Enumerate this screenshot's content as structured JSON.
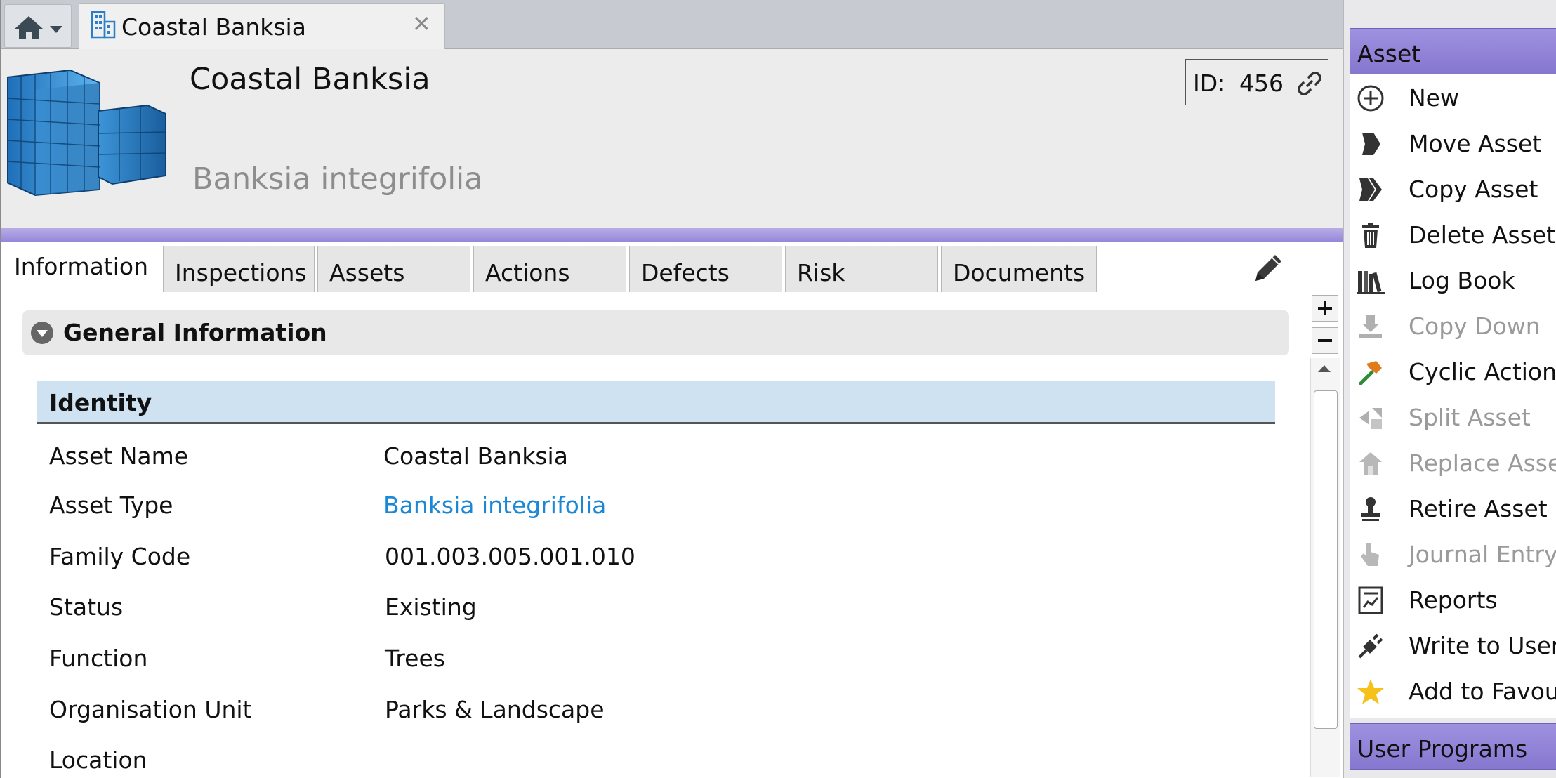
{
  "tab_strip": {
    "document_tab_title": "Coastal Banksia",
    "close_glyph": "✕"
  },
  "header": {
    "asset_title": "Coastal Banksia",
    "asset_subtitle": "Banksia integrifolia",
    "id_label": "ID:",
    "id_value": "456"
  },
  "tabs": [
    {
      "label": "Information"
    },
    {
      "label": "Inspections"
    },
    {
      "label": "Assets"
    },
    {
      "label": "Actions"
    },
    {
      "label": "Defects"
    },
    {
      "label": "Risk"
    },
    {
      "label": "Documents"
    }
  ],
  "general_info": {
    "section_title": "General Information",
    "identity_title": "Identity",
    "fields": [
      {
        "label": "Asset Name",
        "value": "Coastal Banksia"
      },
      {
        "label": "Asset Type",
        "value": "Banksia integrifolia"
      },
      {
        "label": "Family Code",
        "value": "001.003.005.001.010"
      },
      {
        "label": "Status",
        "value": "Existing"
      },
      {
        "label": "Function",
        "value": "Trees"
      },
      {
        "label": "Organisation Unit",
        "value": "Parks & Landscape"
      },
      {
        "label": "Location",
        "value": ""
      }
    ]
  },
  "side_menu": {
    "asset_header": "Asset",
    "items": [
      {
        "label": "New",
        "icon": "plus-circle-icon",
        "enabled": true
      },
      {
        "label": "Move Asset",
        "icon": "arrow-tag-icon",
        "enabled": true
      },
      {
        "label": "Copy Asset",
        "icon": "double-arrow-tag-icon",
        "enabled": true
      },
      {
        "label": "Delete Asset",
        "icon": "trash-icon",
        "enabled": true
      },
      {
        "label": "Log Book",
        "icon": "books-icon",
        "enabled": true
      },
      {
        "label": "Copy Down",
        "icon": "download-tray-icon",
        "enabled": false
      },
      {
        "label": "Cyclic Actions",
        "icon": "hammer-icon",
        "enabled": true
      },
      {
        "label": "Split Asset",
        "icon": "split-icon",
        "enabled": false
      },
      {
        "label": "Replace Asset",
        "icon": "house-replace-icon",
        "enabled": false
      },
      {
        "label": "Retire Asset",
        "icon": "stamp-icon",
        "enabled": true
      },
      {
        "label": "Journal Entry",
        "icon": "hand-pointer-icon",
        "enabled": false
      },
      {
        "label": "Reports",
        "icon": "report-chart-icon",
        "enabled": true
      },
      {
        "label": "Write to User",
        "icon": "plug-icon",
        "enabled": true
      },
      {
        "label": "Add to Favour",
        "icon": "star-icon",
        "enabled": true
      }
    ],
    "user_programs_header": "User Programs"
  },
  "colors": {
    "accent_purple": "#9384d6",
    "link_blue": "#1b88d6",
    "identity_header_bg": "#cfe2f2",
    "star_yellow": "#f6c21a"
  }
}
